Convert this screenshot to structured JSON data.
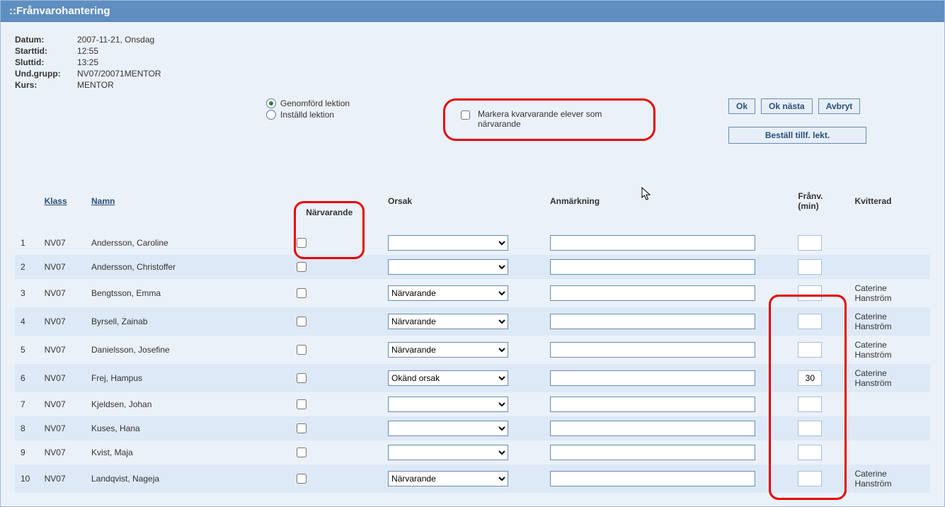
{
  "header": {
    "title": "::Frånvarohantering"
  },
  "info": {
    "labels": {
      "datum": "Datum:",
      "start": "Starttid:",
      "slut": "Sluttid:",
      "grupp": "Und.grupp:",
      "kurs": "Kurs:"
    },
    "values": {
      "datum": "2007-11-21, Onsdag",
      "start": "12:55",
      "slut": "13:25",
      "grupp": "NV07/20071MENTOR",
      "kurs": "MENTOR"
    }
  },
  "radios": {
    "genomford": "Genomförd lektion",
    "installd": "Inställd lektion"
  },
  "markera": {
    "label": "Markera kvarvarande elever som närvarande"
  },
  "buttons": {
    "ok": "Ok",
    "ok_next": "Ok nästa",
    "cancel": "Avbryt",
    "bestall": "Beställ tillf. lekt."
  },
  "table": {
    "headers": {
      "klass": "Klass",
      "namn": "Namn",
      "narvarande": "Närvarande",
      "orsak": "Orsak",
      "anm": "Anmärkning",
      "franv": "Frånv. (min)",
      "kvitterad": "Kvitterad"
    },
    "rows": [
      {
        "idx": "1",
        "klass": "NV07",
        "namn": "Andersson, Caroline",
        "orsak": "",
        "anm": "",
        "franv": "",
        "kvitterad": ""
      },
      {
        "idx": "2",
        "klass": "NV07",
        "namn": "Andersson, Christoffer",
        "orsak": "",
        "anm": "",
        "franv": "",
        "kvitterad": ""
      },
      {
        "idx": "3",
        "klass": "NV07",
        "namn": "Bengtsson, Emma",
        "orsak": "Närvarande",
        "anm": "",
        "franv": "",
        "kvitterad": "Caterine Hanström"
      },
      {
        "idx": "4",
        "klass": "NV07",
        "namn": "Byrsell, Zainab",
        "orsak": "Närvarande",
        "anm": "",
        "franv": "",
        "kvitterad": "Caterine Hanström"
      },
      {
        "idx": "5",
        "klass": "NV07",
        "namn": "Danielsson, Josefine",
        "orsak": "Närvarande",
        "anm": "",
        "franv": "",
        "kvitterad": "Caterine Hanström"
      },
      {
        "idx": "6",
        "klass": "NV07",
        "namn": "Frej, Hampus",
        "orsak": "Okänd orsak",
        "anm": "",
        "franv": "30",
        "kvitterad": "Caterine Hanström"
      },
      {
        "idx": "7",
        "klass": "NV07",
        "namn": "Kjeldsen, Johan",
        "orsak": "",
        "anm": "",
        "franv": "",
        "kvitterad": ""
      },
      {
        "idx": "8",
        "klass": "NV07",
        "namn": "Kuses, Hana",
        "orsak": "",
        "anm": "",
        "franv": "",
        "kvitterad": ""
      },
      {
        "idx": "9",
        "klass": "NV07",
        "namn": "Kvist, Maja",
        "orsak": "",
        "anm": "",
        "franv": "",
        "kvitterad": ""
      },
      {
        "idx": "10",
        "klass": "NV07",
        "namn": "Landqvist, Nageja",
        "orsak": "Närvarande",
        "anm": "",
        "franv": "",
        "kvitterad": "Caterine Hanström"
      }
    ],
    "orsak_options": [
      "",
      "Närvarande",
      "Okänd orsak"
    ]
  }
}
